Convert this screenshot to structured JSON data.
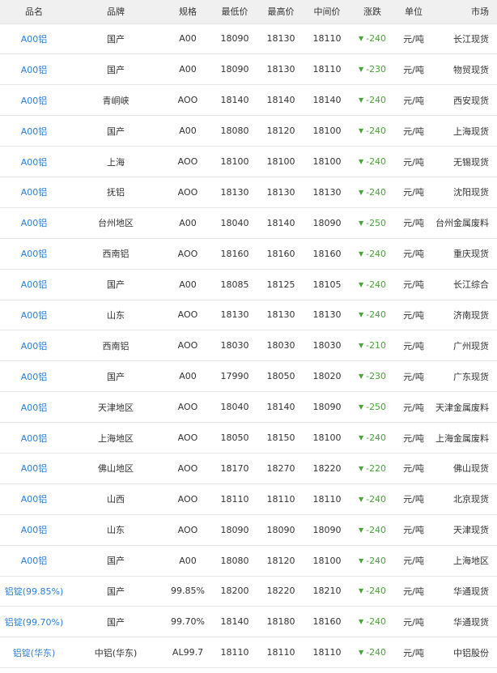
{
  "table": {
    "headers": [
      "品名",
      "品牌",
      "规格",
      "最低价",
      "最高价",
      "中间价",
      "涨跌",
      "单位",
      "市场"
    ],
    "change_arrow": "▼",
    "rows": [
      {
        "name": "A00铝",
        "brand": "国产",
        "spec": "A00",
        "low": "18090",
        "high": "18130",
        "mid": "18110",
        "change": "-240",
        "unit": "元/吨",
        "market": "长江现货"
      },
      {
        "name": "A00铝",
        "brand": "国产",
        "spec": "A00",
        "low": "18090",
        "high": "18130",
        "mid": "18110",
        "change": "-230",
        "unit": "元/吨",
        "market": "物贸现货"
      },
      {
        "name": "A00铝",
        "brand": "青峒峡",
        "spec": "AOO",
        "low": "18140",
        "high": "18140",
        "mid": "18140",
        "change": "-240",
        "unit": "元/吨",
        "market": "西安现货"
      },
      {
        "name": "A00铝",
        "brand": "国产",
        "spec": "A00",
        "low": "18080",
        "high": "18120",
        "mid": "18100",
        "change": "-240",
        "unit": "元/吨",
        "market": "上海现货"
      },
      {
        "name": "A00铝",
        "brand": "上海",
        "spec": "AOO",
        "low": "18100",
        "high": "18100",
        "mid": "18100",
        "change": "-240",
        "unit": "元/吨",
        "market": "无锡现货"
      },
      {
        "name": "A00铝",
        "brand": "抚铝",
        "spec": "AOO",
        "low": "18130",
        "high": "18130",
        "mid": "18130",
        "change": "-240",
        "unit": "元/吨",
        "market": "沈阳现货"
      },
      {
        "name": "A00铝",
        "brand": "台州地区",
        "spec": "A00",
        "low": "18040",
        "high": "18140",
        "mid": "18090",
        "change": "-250",
        "unit": "元/吨",
        "market": "台州金属废料"
      },
      {
        "name": "A00铝",
        "brand": "西南铝",
        "spec": "AOO",
        "low": "18160",
        "high": "18160",
        "mid": "18160",
        "change": "-240",
        "unit": "元/吨",
        "market": "重庆现货"
      },
      {
        "name": "A00铝",
        "brand": "国产",
        "spec": "A00",
        "low": "18085",
        "high": "18125",
        "mid": "18105",
        "change": "-240",
        "unit": "元/吨",
        "market": "长江综合"
      },
      {
        "name": "A00铝",
        "brand": "山东",
        "spec": "AOO",
        "low": "18130",
        "high": "18130",
        "mid": "18130",
        "change": "-240",
        "unit": "元/吨",
        "market": "济南现货"
      },
      {
        "name": "A00铝",
        "brand": "西南铝",
        "spec": "AOO",
        "low": "18030",
        "high": "18030",
        "mid": "18030",
        "change": "-210",
        "unit": "元/吨",
        "market": "广州现货"
      },
      {
        "name": "A00铝",
        "brand": "国产",
        "spec": "A00",
        "low": "17990",
        "high": "18050",
        "mid": "18020",
        "change": "-230",
        "unit": "元/吨",
        "market": "广东现货"
      },
      {
        "name": "A00铝",
        "brand": "天津地区",
        "spec": "AOO",
        "low": "18040",
        "high": "18140",
        "mid": "18090",
        "change": "-250",
        "unit": "元/吨",
        "market": "天津金属废料"
      },
      {
        "name": "A00铝",
        "brand": "上海地区",
        "spec": "AOO",
        "low": "18050",
        "high": "18150",
        "mid": "18100",
        "change": "-240",
        "unit": "元/吨",
        "market": "上海金属废料"
      },
      {
        "name": "A00铝",
        "brand": "佛山地区",
        "spec": "AOO",
        "low": "18170",
        "high": "18270",
        "mid": "18220",
        "change": "-220",
        "unit": "元/吨",
        "market": "佛山现货"
      },
      {
        "name": "A00铝",
        "brand": "山西",
        "spec": "AOO",
        "low": "18110",
        "high": "18110",
        "mid": "18110",
        "change": "-240",
        "unit": "元/吨",
        "market": "北京现货"
      },
      {
        "name": "A00铝",
        "brand": "山东",
        "spec": "AOO",
        "low": "18090",
        "high": "18090",
        "mid": "18090",
        "change": "-240",
        "unit": "元/吨",
        "market": "天津现货"
      },
      {
        "name": "A00铝",
        "brand": "国产",
        "spec": "A00",
        "low": "18080",
        "high": "18120",
        "mid": "18100",
        "change": "-240",
        "unit": "元/吨",
        "market": "上海地区"
      },
      {
        "name": "铝锭(99.85%)",
        "brand": "国产",
        "spec": "99.85%",
        "low": "18200",
        "high": "18220",
        "mid": "18210",
        "change": "-240",
        "unit": "元/吨",
        "market": "华通现货"
      },
      {
        "name": "铝锭(99.70%)",
        "brand": "国产",
        "spec": "99.70%",
        "low": "18140",
        "high": "18180",
        "mid": "18160",
        "change": "-240",
        "unit": "元/吨",
        "market": "华通现货"
      },
      {
        "name": "铝锭(华东)",
        "brand": "中铝(华东)",
        "spec": "AL99.7",
        "low": "18110",
        "high": "18110",
        "mid": "18110",
        "change": "-240",
        "unit": "元/吨",
        "market": "中铝股份"
      }
    ]
  }
}
